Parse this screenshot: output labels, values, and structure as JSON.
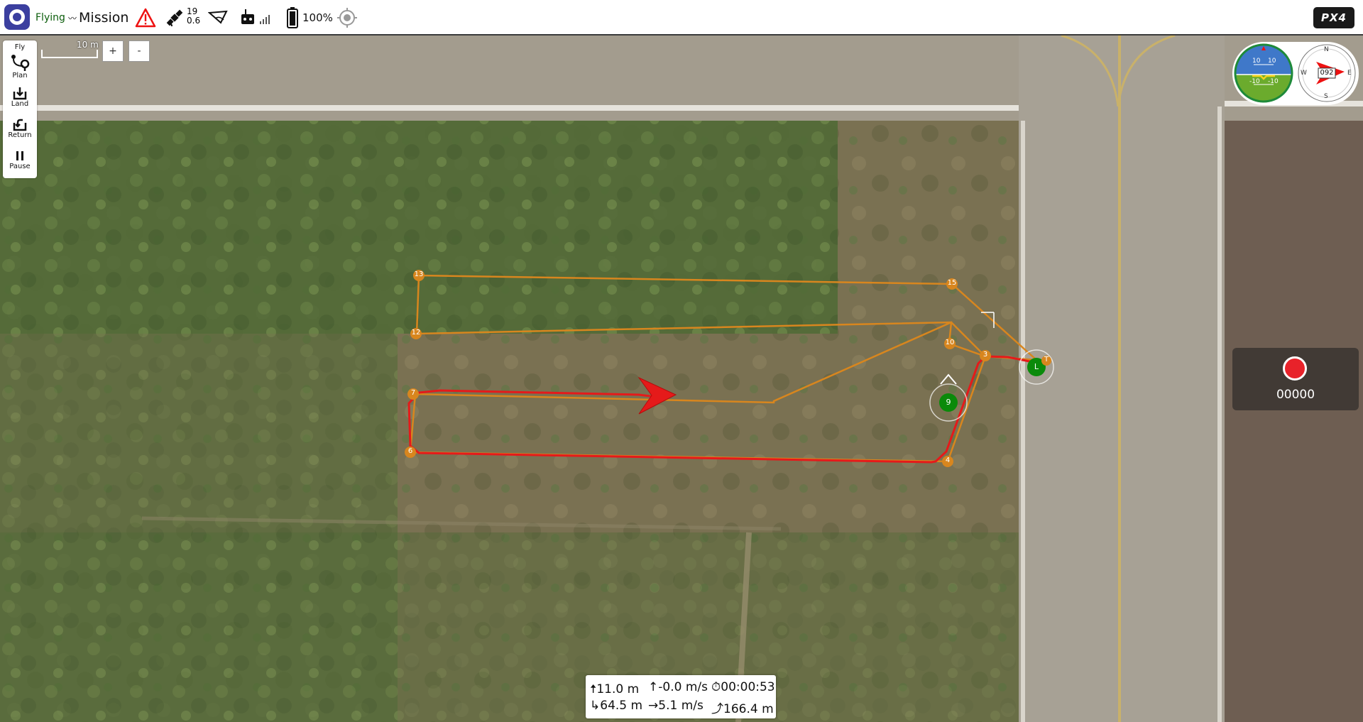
{
  "toolbar": {
    "flight_mode_status": "Flying",
    "flight_mode": "Mission",
    "satellite_count": "19",
    "hdop": "0.6",
    "battery_percent": "100%",
    "brand": "PX4"
  },
  "fly_tools": [
    {
      "label": "Fly",
      "icon": "fly-icon"
    },
    {
      "label": "Plan",
      "icon": "plan-route-icon"
    },
    {
      "label": "Land",
      "icon": "land-icon"
    },
    {
      "label": "Return",
      "icon": "return-icon"
    },
    {
      "label": "Pause",
      "icon": "pause-icon"
    }
  ],
  "map": {
    "scale_label": "10 m",
    "zoom_in_label": "+",
    "zoom_out_label": "-",
    "waypoints": [
      "3",
      "4",
      "6",
      "7",
      "9",
      "10",
      "12",
      "13",
      "15"
    ],
    "current_waypoint": "9",
    "launch_label": "L",
    "takeoff_label": "T"
  },
  "instrument": {
    "heading": "092",
    "pitch_labels": [
      "10",
      "10",
      "-10",
      "-10"
    ],
    "compass": [
      "N",
      "E",
      "S",
      "W"
    ]
  },
  "recording": {
    "time": "00000"
  },
  "telemetry": {
    "altitude": "11.0 m",
    "vertical_speed": "-0.0 m/s",
    "flight_time": "00:00:53",
    "distance_home": "64.5 m",
    "ground_speed": "5.1 m/s",
    "distance_traveled": "166.4 m"
  },
  "colors": {
    "mission_path": "#d8861e",
    "flight_track": "#e51a1a",
    "current_waypoint": "#0a8a0a",
    "record_button": "#e8222a"
  }
}
